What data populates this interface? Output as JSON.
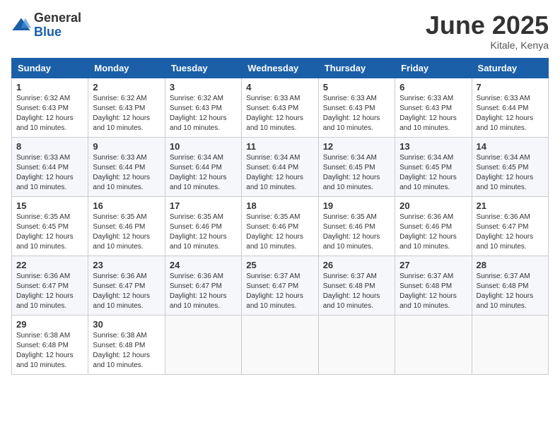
{
  "logo": {
    "general": "General",
    "blue": "Blue"
  },
  "header": {
    "month": "June 2025",
    "location": "Kitale, Kenya"
  },
  "weekdays": [
    "Sunday",
    "Monday",
    "Tuesday",
    "Wednesday",
    "Thursday",
    "Friday",
    "Saturday"
  ],
  "weeks": [
    [
      {
        "day": "1",
        "sunrise": "6:32 AM",
        "sunset": "6:43 PM",
        "daylight": "12 hours and 10 minutes."
      },
      {
        "day": "2",
        "sunrise": "6:32 AM",
        "sunset": "6:43 PM",
        "daylight": "12 hours and 10 minutes."
      },
      {
        "day": "3",
        "sunrise": "6:32 AM",
        "sunset": "6:43 PM",
        "daylight": "12 hours and 10 minutes."
      },
      {
        "day": "4",
        "sunrise": "6:33 AM",
        "sunset": "6:43 PM",
        "daylight": "12 hours and 10 minutes."
      },
      {
        "day": "5",
        "sunrise": "6:33 AM",
        "sunset": "6:43 PM",
        "daylight": "12 hours and 10 minutes."
      },
      {
        "day": "6",
        "sunrise": "6:33 AM",
        "sunset": "6:43 PM",
        "daylight": "12 hours and 10 minutes."
      },
      {
        "day": "7",
        "sunrise": "6:33 AM",
        "sunset": "6:44 PM",
        "daylight": "12 hours and 10 minutes."
      }
    ],
    [
      {
        "day": "8",
        "sunrise": "6:33 AM",
        "sunset": "6:44 PM",
        "daylight": "12 hours and 10 minutes."
      },
      {
        "day": "9",
        "sunrise": "6:33 AM",
        "sunset": "6:44 PM",
        "daylight": "12 hours and 10 minutes."
      },
      {
        "day": "10",
        "sunrise": "6:34 AM",
        "sunset": "6:44 PM",
        "daylight": "12 hours and 10 minutes."
      },
      {
        "day": "11",
        "sunrise": "6:34 AM",
        "sunset": "6:44 PM",
        "daylight": "12 hours and 10 minutes."
      },
      {
        "day": "12",
        "sunrise": "6:34 AM",
        "sunset": "6:45 PM",
        "daylight": "12 hours and 10 minutes."
      },
      {
        "day": "13",
        "sunrise": "6:34 AM",
        "sunset": "6:45 PM",
        "daylight": "12 hours and 10 minutes."
      },
      {
        "day": "14",
        "sunrise": "6:34 AM",
        "sunset": "6:45 PM",
        "daylight": "12 hours and 10 minutes."
      }
    ],
    [
      {
        "day": "15",
        "sunrise": "6:35 AM",
        "sunset": "6:45 PM",
        "daylight": "12 hours and 10 minutes."
      },
      {
        "day": "16",
        "sunrise": "6:35 AM",
        "sunset": "6:46 PM",
        "daylight": "12 hours and 10 minutes."
      },
      {
        "day": "17",
        "sunrise": "6:35 AM",
        "sunset": "6:46 PM",
        "daylight": "12 hours and 10 minutes."
      },
      {
        "day": "18",
        "sunrise": "6:35 AM",
        "sunset": "6:46 PM",
        "daylight": "12 hours and 10 minutes."
      },
      {
        "day": "19",
        "sunrise": "6:35 AM",
        "sunset": "6:46 PM",
        "daylight": "12 hours and 10 minutes."
      },
      {
        "day": "20",
        "sunrise": "6:36 AM",
        "sunset": "6:46 PM",
        "daylight": "12 hours and 10 minutes."
      },
      {
        "day": "21",
        "sunrise": "6:36 AM",
        "sunset": "6:47 PM",
        "daylight": "12 hours and 10 minutes."
      }
    ],
    [
      {
        "day": "22",
        "sunrise": "6:36 AM",
        "sunset": "6:47 PM",
        "daylight": "12 hours and 10 minutes."
      },
      {
        "day": "23",
        "sunrise": "6:36 AM",
        "sunset": "6:47 PM",
        "daylight": "12 hours and 10 minutes."
      },
      {
        "day": "24",
        "sunrise": "6:36 AM",
        "sunset": "6:47 PM",
        "daylight": "12 hours and 10 minutes."
      },
      {
        "day": "25",
        "sunrise": "6:37 AM",
        "sunset": "6:47 PM",
        "daylight": "12 hours and 10 minutes."
      },
      {
        "day": "26",
        "sunrise": "6:37 AM",
        "sunset": "6:48 PM",
        "daylight": "12 hours and 10 minutes."
      },
      {
        "day": "27",
        "sunrise": "6:37 AM",
        "sunset": "6:48 PM",
        "daylight": "12 hours and 10 minutes."
      },
      {
        "day": "28",
        "sunrise": "6:37 AM",
        "sunset": "6:48 PM",
        "daylight": "12 hours and 10 minutes."
      }
    ],
    [
      {
        "day": "29",
        "sunrise": "6:38 AM",
        "sunset": "6:48 PM",
        "daylight": "12 hours and 10 minutes."
      },
      {
        "day": "30",
        "sunrise": "6:38 AM",
        "sunset": "6:48 PM",
        "daylight": "12 hours and 10 minutes."
      },
      null,
      null,
      null,
      null,
      null
    ]
  ]
}
